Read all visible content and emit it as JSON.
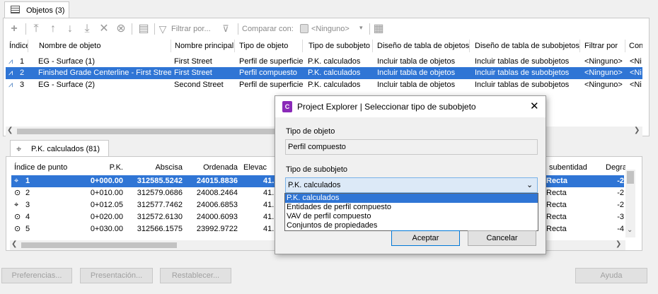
{
  "top_tab": {
    "label": "Objetos (3)"
  },
  "toolbar": {
    "filter_label": "Filtrar por...",
    "compare_label": "Comparar con:",
    "compare_value": "<Ninguno>"
  },
  "objects_table": {
    "headers": [
      "Índice",
      "Nombre de objeto",
      "Nombre principal",
      "Tipo de objeto",
      "Tipo de subobjeto",
      "Diseño de tabla de objetos",
      "Diseño de tabla de subobjetos",
      "Filtrar por",
      "Con"
    ],
    "rows": [
      [
        "1",
        "EG - Surface (1)",
        "First Street",
        "Perfil de superficie",
        "P.K. calculados",
        "Incluir tabla de objetos",
        "Incluir tablas de subobjetos",
        "<Ninguno>",
        "<Ni"
      ],
      [
        "2",
        "Finished Grade Centerline - First Street",
        "First Street",
        "Perfil compuesto",
        "P.K. calculados",
        "Incluir tabla de objetos",
        "Incluir tablas de subobjetos",
        "<Ninguno>",
        "<Ni"
      ],
      [
        "3",
        "EG - Surface (2)",
        "Second Street",
        "Perfil de superficie",
        "P.K. calculados",
        "Incluir tabla de objetos",
        "Incluir tablas de subobjetos",
        "<Ninguno>",
        "<Ni"
      ]
    ]
  },
  "bottom_tab": {
    "label": "P.K. calculados (81)"
  },
  "points_table": {
    "headers": [
      "Índice de punto",
      "P.K.",
      "Abscisa",
      "Ordenada",
      "Elevac",
      "subentidad",
      "Degra"
    ],
    "rows": [
      [
        "1",
        "0+000.00",
        "312585.5242",
        "24015.8836",
        "41.",
        "Recta",
        "-2"
      ],
      [
        "2",
        "0+010.00",
        "312579.0686",
        "24008.2464",
        "41.",
        "Recta",
        "-2"
      ],
      [
        "3",
        "0+012.05",
        "312577.7462",
        "24006.6853",
        "41.",
        "Recta",
        "-2"
      ],
      [
        "4",
        "0+020.00",
        "312572.6130",
        "24000.6093",
        "41.",
        "Recta",
        "-3"
      ],
      [
        "5",
        "0+030.00",
        "312566.1575",
        "23992.9722",
        "41.",
        "Recta",
        "-4"
      ]
    ]
  },
  "bottom_buttons": {
    "prefs": "Preferencias...",
    "presentation": "Presentación...",
    "reset": "Restablecer...",
    "help": "Ayuda"
  },
  "dialog": {
    "title": "Project Explorer | Seleccionar tipo de subobjeto",
    "object_type_label": "Tipo de objeto",
    "object_type_value": "Perfil compuesto",
    "subobject_type_label": "Tipo de subobjeto",
    "subobject_selected": "P.K. calculados",
    "options": [
      "P.K. calculados",
      "Entidades de perfil compuesto",
      "VAV de perfil compuesto",
      "Conjuntos de propiedades"
    ],
    "accept": "Aceptar",
    "cancel": "Cancelar"
  }
}
